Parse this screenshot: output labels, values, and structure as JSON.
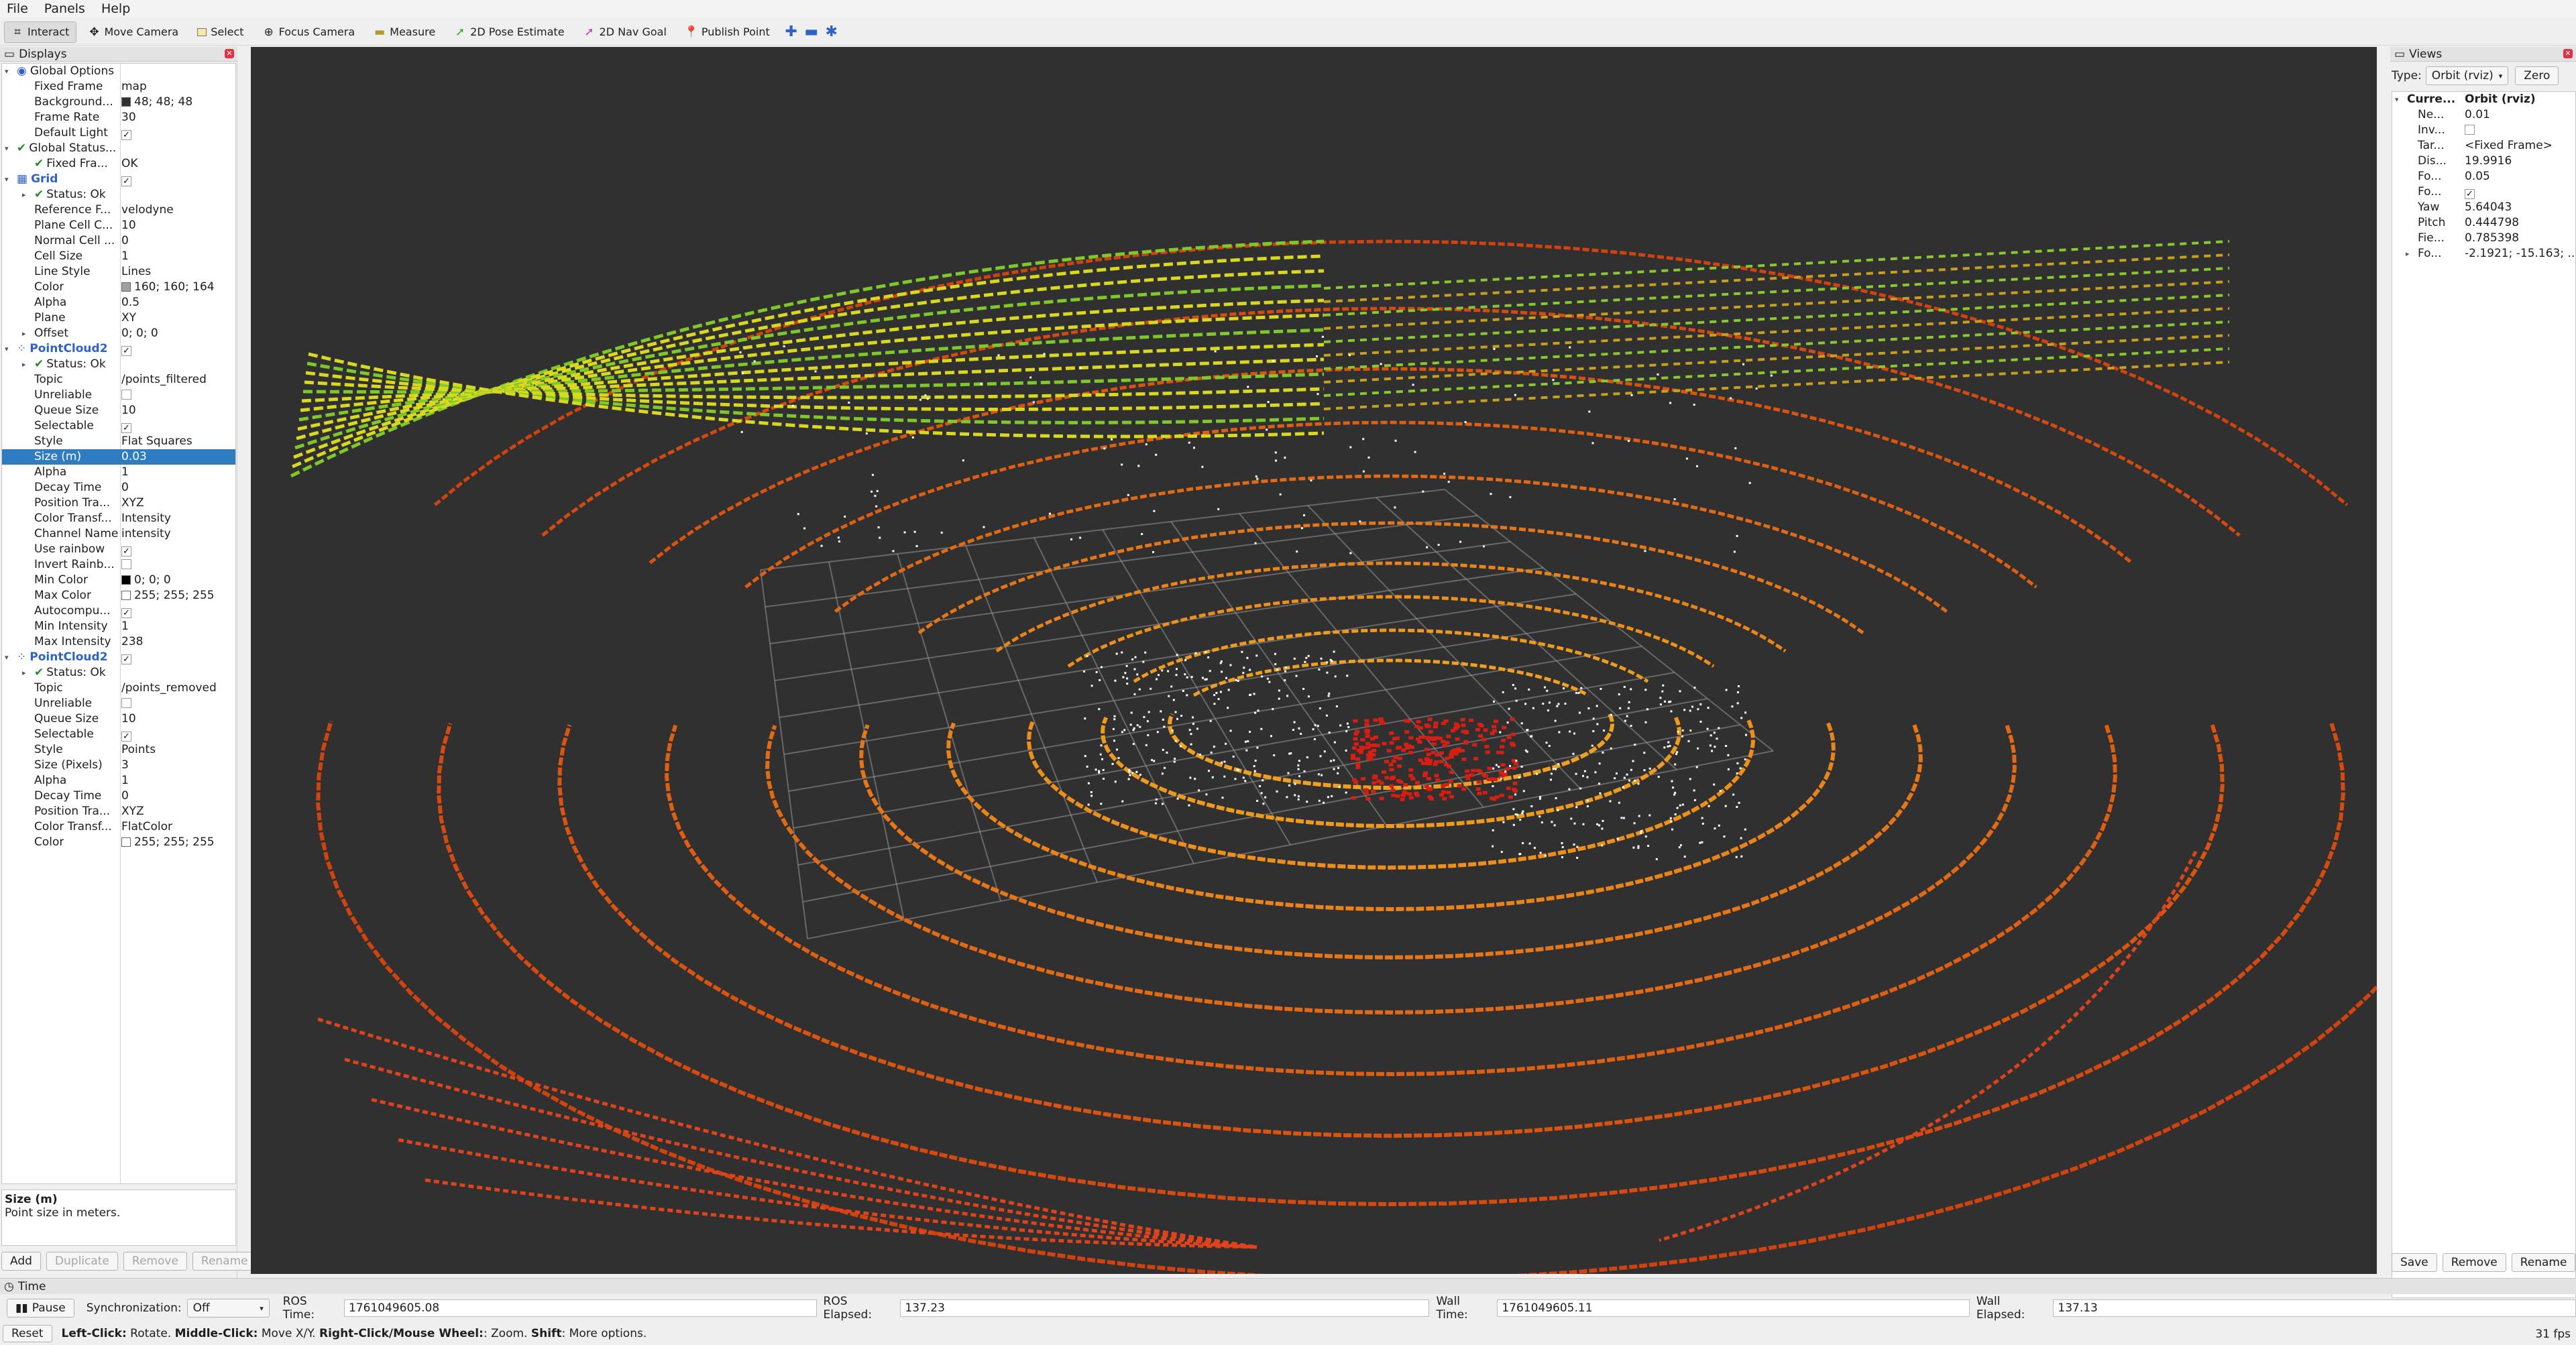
{
  "menu": {
    "file": "File",
    "panels": "Panels",
    "help": "Help"
  },
  "toolbar": {
    "interact": "Interact",
    "move": "Move Camera",
    "select": "Select",
    "focus": "Focus Camera",
    "measure": "Measure",
    "pose": "2D Pose Estimate",
    "nav": "2D Nav Goal",
    "publish": "Publish Point"
  },
  "displays": {
    "title": "Displays",
    "rows": [
      {
        "name": "Global Options",
        "value": ""
      },
      {
        "name": "Fixed Frame",
        "value": "map"
      },
      {
        "name": "Background...",
        "value": "48; 48; 48"
      },
      {
        "name": "Frame Rate",
        "value": "30"
      },
      {
        "name": "Default Light",
        "value": ""
      },
      {
        "name": "Global Status...",
        "value": ""
      },
      {
        "name": "Fixed Fra...",
        "value": "OK"
      },
      {
        "name": "Grid",
        "value": ""
      },
      {
        "name": "Status: Ok",
        "value": ""
      },
      {
        "name": "Reference F...",
        "value": "velodyne"
      },
      {
        "name": "Plane Cell C...",
        "value": "10"
      },
      {
        "name": "Normal Cell ...",
        "value": "0"
      },
      {
        "name": "Cell Size",
        "value": "1"
      },
      {
        "name": "Line Style",
        "value": "Lines"
      },
      {
        "name": "Color",
        "value": "160; 160; 164"
      },
      {
        "name": "Alpha",
        "value": "0.5"
      },
      {
        "name": "Plane",
        "value": "XY"
      },
      {
        "name": "Offset",
        "value": "0; 0; 0"
      },
      {
        "name": "PointCloud2",
        "value": ""
      },
      {
        "name": "Status: Ok",
        "value": ""
      },
      {
        "name": "Topic",
        "value": "/points_filtered"
      },
      {
        "name": "Unreliable",
        "value": ""
      },
      {
        "name": "Queue Size",
        "value": "10"
      },
      {
        "name": "Selectable",
        "value": ""
      },
      {
        "name": "Style",
        "value": "Flat Squares"
      },
      {
        "name": "Size (m)",
        "value": "0.03"
      },
      {
        "name": "Alpha",
        "value": "1"
      },
      {
        "name": "Decay Time",
        "value": "0"
      },
      {
        "name": "Position Tra...",
        "value": "XYZ"
      },
      {
        "name": "Color Transf...",
        "value": "Intensity"
      },
      {
        "name": "Channel Name",
        "value": "intensity"
      },
      {
        "name": "Use rainbow",
        "value": ""
      },
      {
        "name": "Invert Rainb...",
        "value": ""
      },
      {
        "name": "Min Color",
        "value": "0; 0; 0"
      },
      {
        "name": "Max Color",
        "value": "255; 255; 255"
      },
      {
        "name": "Autocompu...",
        "value": ""
      },
      {
        "name": "Min Intensity",
        "value": "1"
      },
      {
        "name": "Max Intensity",
        "value": "238"
      },
      {
        "name": "PointCloud2",
        "value": ""
      },
      {
        "name": "Status: Ok",
        "value": ""
      },
      {
        "name": "Topic",
        "value": "/points_removed"
      },
      {
        "name": "Unreliable",
        "value": ""
      },
      {
        "name": "Queue Size",
        "value": "10"
      },
      {
        "name": "Selectable",
        "value": ""
      },
      {
        "name": "Style",
        "value": "Points"
      },
      {
        "name": "Size (Pixels)",
        "value": "3"
      },
      {
        "name": "Alpha",
        "value": "1"
      },
      {
        "name": "Decay Time",
        "value": "0"
      },
      {
        "name": "Position Tra...",
        "value": "XYZ"
      },
      {
        "name": "Color Transf...",
        "value": "FlatColor"
      },
      {
        "name": "Color",
        "value": "255; 255; 255"
      }
    ],
    "desc_title": "Size (m)",
    "desc_text": "Point size in meters.",
    "buttons": {
      "add": "Add",
      "duplicate": "Duplicate",
      "remove": "Remove",
      "rename": "Rename"
    }
  },
  "colors": {
    "background": "#303030",
    "grid": "#a0a0a4",
    "selected": "#2f7dc0"
  },
  "views": {
    "title": "Views",
    "type_label": "Type:",
    "type_value": "Orbit (rviz)",
    "zero": "Zero",
    "rows": [
      {
        "name": "Curre...",
        "value": "Orbit (rviz)"
      },
      {
        "name": "Ne...",
        "value": "0.01"
      },
      {
        "name": "Inv...",
        "value": ""
      },
      {
        "name": "Tar...",
        "value": "<Fixed Frame>"
      },
      {
        "name": "Dis...",
        "value": "19.9916"
      },
      {
        "name": "Fo...",
        "value": "0.05"
      },
      {
        "name": "Fo...",
        "value": ""
      },
      {
        "name": "Yaw",
        "value": "5.64043"
      },
      {
        "name": "Pitch",
        "value": "0.444798"
      },
      {
        "name": "Fie...",
        "value": "0.785398"
      },
      {
        "name": "Fo...",
        "value": "-2.1921; -15.163; ..."
      }
    ],
    "buttons": {
      "save": "Save",
      "remove": "Remove",
      "rename": "Rename"
    }
  },
  "time": {
    "title": "Time",
    "pause": "Pause",
    "sync_label": "Synchronization:",
    "sync_value": "Off",
    "ros_time_label": "ROS Time:",
    "ros_time": "1761049605.08",
    "ros_elapsed_label": "ROS Elapsed:",
    "ros_elapsed": "137.23",
    "wall_time_label": "Wall Time:",
    "wall_time": "1761049605.11",
    "wall_elapsed_label": "Wall Elapsed:",
    "wall_elapsed": "137.13"
  },
  "status": {
    "reset": "Reset",
    "lc": "Left-Click:",
    "lc_t": " Rotate. ",
    "mc": "Middle-Click:",
    "mc_t": " Move X/Y. ",
    "rc": "Right-Click/Mouse Wheel:",
    "rc_t": ": Zoom. ",
    "sh": "Shift",
    "sh_t": ": More options.",
    "fps": "31 fps"
  }
}
